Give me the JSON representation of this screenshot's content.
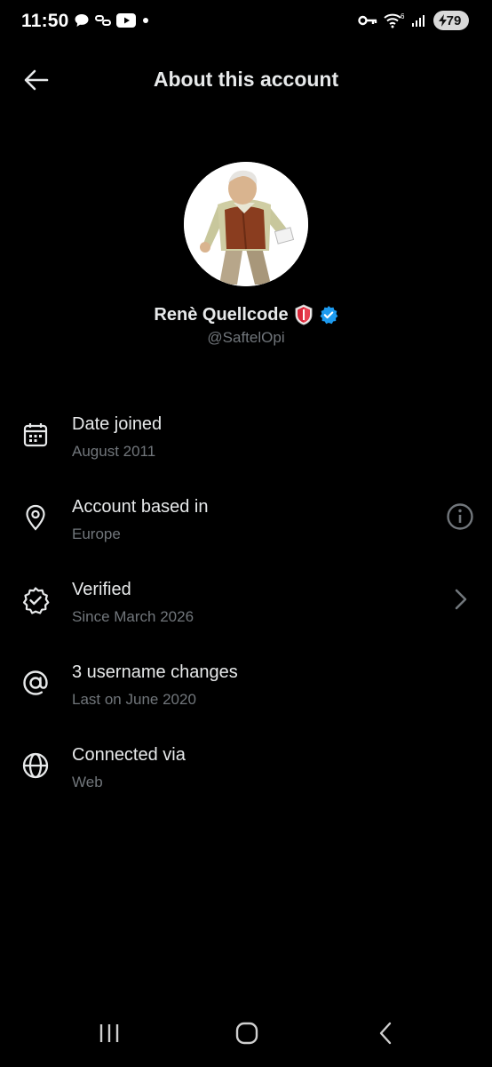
{
  "status_bar": {
    "time": "11:50",
    "battery_level": "79",
    "wifi_label": "6",
    "icons_left": [
      "chat-bubble-icon",
      "link-icon",
      "youtube-icon",
      "dot-icon"
    ],
    "icons_right": [
      "key-icon",
      "wifi-icon",
      "signal-icon",
      "battery-icon"
    ]
  },
  "header": {
    "title": "About this account",
    "back_icon": "arrow-left-icon"
  },
  "profile": {
    "display_name": "Renè Quellcode",
    "handle": "@SaftelOpi",
    "badges": [
      "shield-emoji-icon",
      "verified-badge-icon"
    ],
    "verified_color": "#1d9bf0"
  },
  "info_items": [
    {
      "icon": "calendar-icon",
      "title": "Date joined",
      "subtitle": "August 2011"
    },
    {
      "icon": "location-pin-icon",
      "title": "Account based in",
      "subtitle": "Europe",
      "action_icon": "info-circle-icon"
    },
    {
      "icon": "verified-outline-icon",
      "title": "Verified",
      "subtitle": "Since March 2026",
      "action_icon": "chevron-right-icon"
    },
    {
      "icon": "at-sign-icon",
      "title": "3 username changes",
      "subtitle": "Last on June 2020"
    },
    {
      "icon": "globe-icon",
      "title": "Connected via",
      "subtitle": "Web"
    }
  ],
  "nav_bar": {
    "buttons": [
      "recent-apps-icon",
      "home-icon",
      "back-icon"
    ]
  },
  "colors": {
    "background": "#000000",
    "primary_text": "#e7e9ea",
    "secondary_text": "#71767b",
    "accent": "#1d9bf0"
  }
}
